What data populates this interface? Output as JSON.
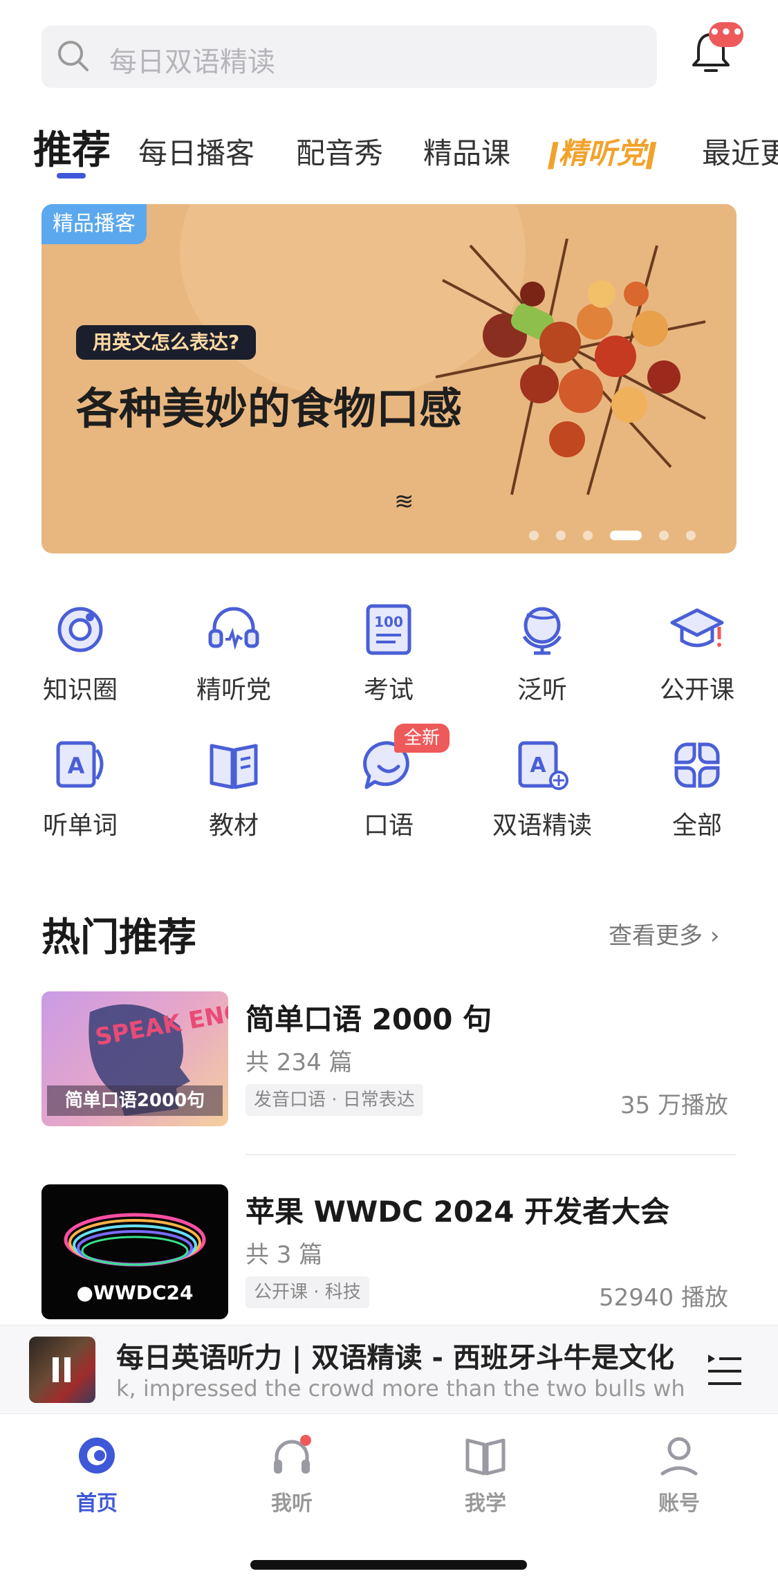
{
  "search": {
    "placeholder": "每日双语精读"
  },
  "notification": {
    "badge": "•••"
  },
  "tabs": [
    {
      "label": "推荐",
      "active": true
    },
    {
      "label": "每日播客"
    },
    {
      "label": "配音秀"
    },
    {
      "label": "精品课"
    },
    {
      "label": "精听党",
      "special": true
    },
    {
      "label": "最近更"
    }
  ],
  "banner": {
    "tag": "精品播客",
    "pill": "用英文怎么表达?",
    "title": "各种美妙的食物口感",
    "wave": "≋",
    "slide_count": 6,
    "active_slide": 4
  },
  "grid": [
    {
      "label": "知识圈",
      "icon": "knowledge-circle-icon"
    },
    {
      "label": "精听党",
      "icon": "headset-icon"
    },
    {
      "label": "考试",
      "icon": "exam-100-icon"
    },
    {
      "label": "泛听",
      "icon": "globe-icon"
    },
    {
      "label": "公开课",
      "icon": "graduation-cap-icon"
    },
    {
      "label": "听单词",
      "icon": "word-card-icon"
    },
    {
      "label": "教材",
      "icon": "book-icon"
    },
    {
      "label": "口语",
      "icon": "speech-bubble-icon",
      "badge": "全新"
    },
    {
      "label": "双语精读",
      "icon": "bilingual-reading-icon"
    },
    {
      "label": "全部",
      "icon": "all-grid-icon"
    }
  ],
  "hot": {
    "title": "热门推荐",
    "more": "查看更多",
    "items": [
      {
        "title": "简单口语 2000 句",
        "count": "共 234 篇",
        "tag": "发音口语 · 日常表达",
        "plays": "35 万播放",
        "thumb_text": "简单口语2000句",
        "thumb_art": "SPEAK ENGLISH ?"
      },
      {
        "title": "苹果 WWDC 2024 开发者大会",
        "count": "共 3 篇",
        "tag": "公开课 · 科技",
        "plays": "52940 播放",
        "thumb_text": "WWDC24"
      }
    ]
  },
  "player": {
    "title": "每日英语听力 | 双语精读 - 西班牙斗牛是文化",
    "subtitle": "k, impressed the crowd more than the two bulls which"
  },
  "nav": [
    {
      "label": "首页",
      "icon": "home-icon",
      "active": true
    },
    {
      "label": "我听",
      "icon": "listen-icon",
      "dot": true
    },
    {
      "label": "我学",
      "icon": "study-book-icon"
    },
    {
      "label": "账号",
      "icon": "account-icon"
    }
  ],
  "colors": {
    "accent": "#3f58d8",
    "badge": "#ee5a5a",
    "banner_bg": "#e8b780",
    "special_tab": "#f2a22b"
  }
}
